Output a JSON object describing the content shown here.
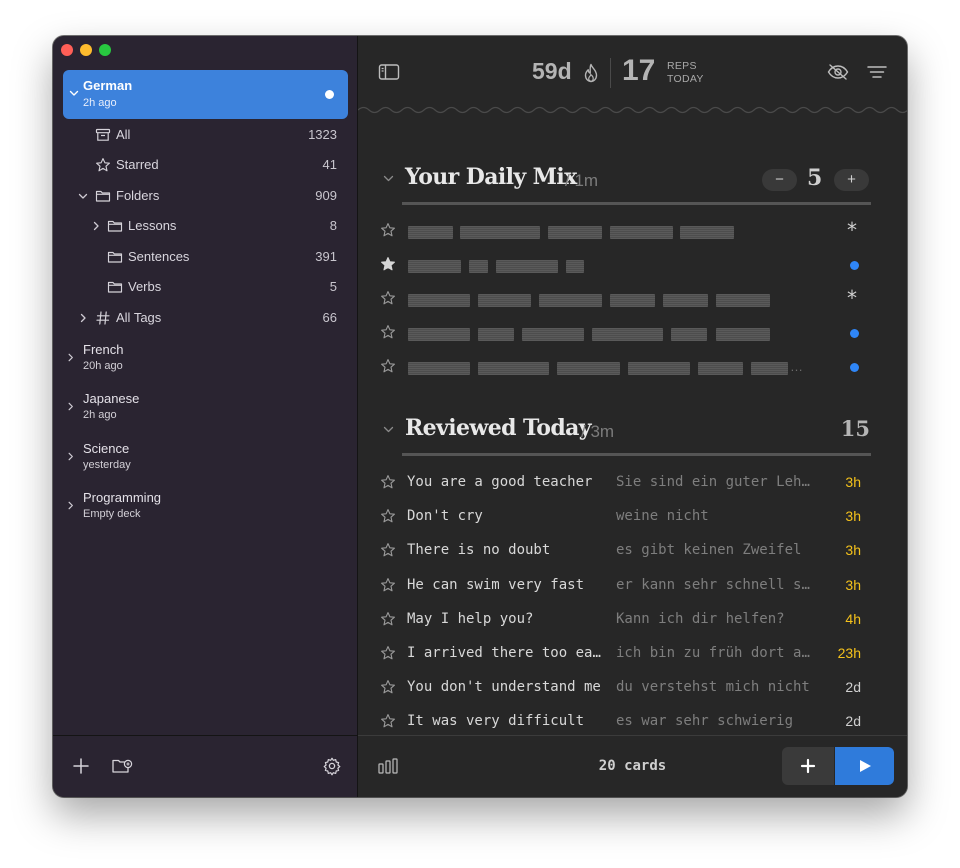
{
  "sidebar": {
    "active_deck": {
      "name": "German",
      "subtitle": "2h ago"
    },
    "tree": [
      {
        "label": "All",
        "count": "1323"
      },
      {
        "label": "Starred",
        "count": "41"
      },
      {
        "label": "Folders",
        "count": "909"
      },
      {
        "label": "Lessons",
        "count": "8"
      },
      {
        "label": "Sentences",
        "count": "391"
      },
      {
        "label": "Verbs",
        "count": "5"
      },
      {
        "label": "All Tags",
        "count": "66"
      }
    ],
    "decks": [
      {
        "name": "French",
        "subtitle": "20h ago"
      },
      {
        "name": "Japanese",
        "subtitle": "2h ago"
      },
      {
        "name": "Science",
        "subtitle": "yesterday"
      },
      {
        "name": "Programming",
        "subtitle": "Empty deck"
      }
    ]
  },
  "toolbar": {
    "streak": "59d",
    "reps_count": "17",
    "reps_label_1": "REPS",
    "reps_label_2": "TODAY"
  },
  "daily_mix": {
    "title": "Your Daily Mix",
    "duration": "/ 1m",
    "stepper_value": "5",
    "minus": "−",
    "plus": "+",
    "ellipsis": "…"
  },
  "reviewed_today": {
    "title": "Reviewed Today",
    "duration": "/ 3m",
    "count": "15",
    "rows": [
      {
        "en": "You are a good teacher",
        "de": "Sie sind ein guter Lehrer",
        "due": "3h",
        "color": "#f5c21b"
      },
      {
        "en": "Don't cry",
        "de": "weine nicht",
        "due": "3h",
        "color": "#f5c21b"
      },
      {
        "en": "There is no doubt",
        "de": "es gibt keinen Zweifel",
        "due": "3h",
        "color": "#f5c21b"
      },
      {
        "en": "He can swim very fast",
        "de": "er kann sehr schnell schwimmen",
        "due": "3h",
        "color": "#f5c21b"
      },
      {
        "en": "May I help you?",
        "de": "Kann ich dir helfen?",
        "due": "4h",
        "color": "#f5c21b"
      },
      {
        "en": "I arrived there too early",
        "de": "ich bin zu früh dort angekommen",
        "due": "23h",
        "color": "#f5c21b"
      },
      {
        "en": "You don't understand me",
        "de": "du verstehst mich nicht",
        "due": "2d",
        "color": "#d0d0d0"
      },
      {
        "en": "It was very difficult",
        "de": "es war sehr schwierig",
        "due": "2d",
        "color": "#d0d0d0"
      }
    ]
  },
  "footer": {
    "cards": "20 cards"
  },
  "colors": {
    "accent": "#3d82dc",
    "blue_dot": "#2f86f7",
    "due_soon": "#f5c21b"
  }
}
